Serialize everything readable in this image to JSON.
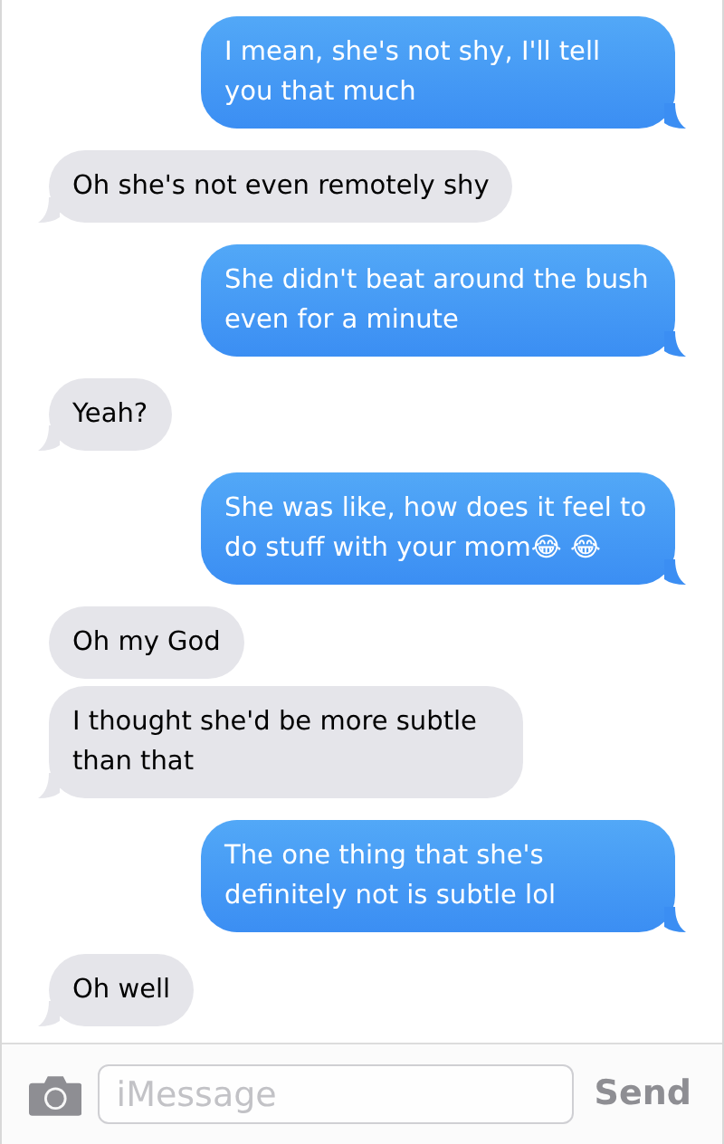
{
  "messages": [
    {
      "kind": "sent",
      "text": "I mean, she's not shy, I'll tell you that much"
    },
    {
      "kind": "received",
      "text": "Oh she's not even remotely shy"
    },
    {
      "kind": "sent",
      "text": "She didn't beat around the bush even for a minute"
    },
    {
      "kind": "received",
      "text": "Yeah?"
    },
    {
      "kind": "sent",
      "text": "She was like, how does it feel to do stuff with your mom😂 😂"
    },
    {
      "kind": "received",
      "text": "Oh my God"
    },
    {
      "kind": "received",
      "text": "I thought she'd be more subtle than that"
    },
    {
      "kind": "sent",
      "text": "The one thing that she's definitely not is subtle lol"
    },
    {
      "kind": "received",
      "text": "Oh well"
    }
  ],
  "composer": {
    "placeholder": "iMessage",
    "send": "Send"
  }
}
